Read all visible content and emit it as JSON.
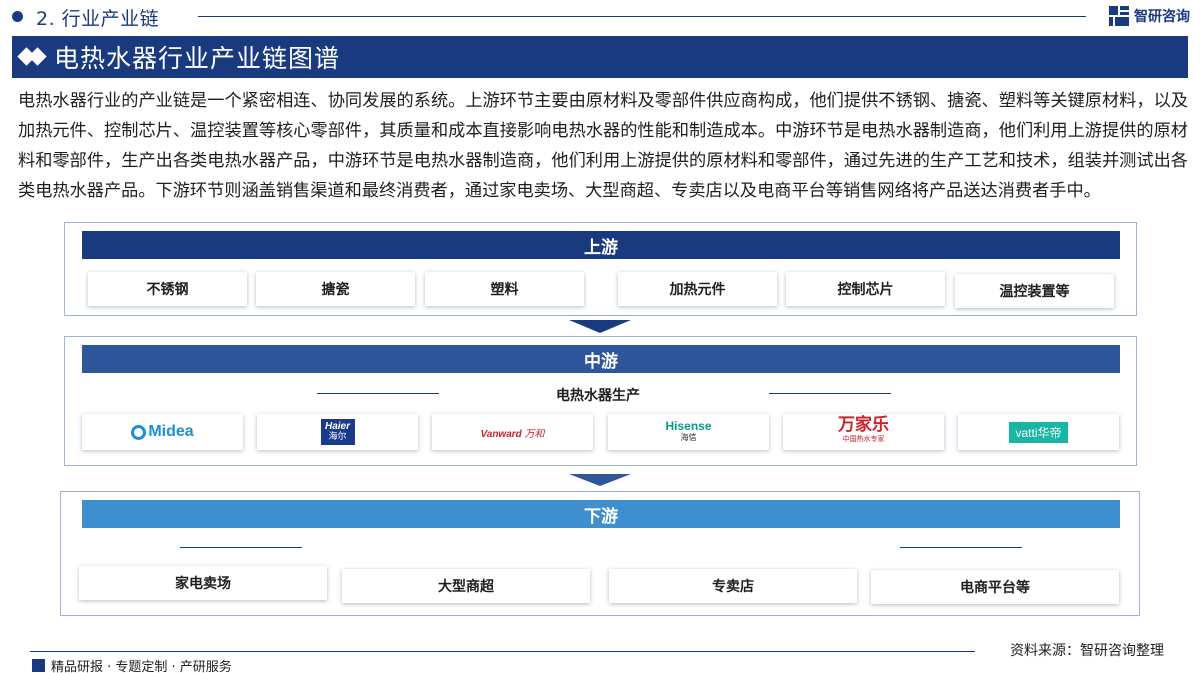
{
  "header": {
    "section_title": "2. 行业产业链",
    "brand_name": "智研咨询"
  },
  "banner": {
    "title": "电热水器行业产业链图谱"
  },
  "intro": "电热水器行业的产业链是一个紧密相连、协同发展的系统。上游环节主要由原材料及零部件供应商构成，他们提供不锈钢、搪瓷、塑料等关键原材料，以及加热元件、控制芯片、温控装置等核心零部件，其质量和成本直接影响电热水器的性能和制造成本。中游环节是电热水器制造商，他们利用上游提供的原材料和零部件，生产出各类电热水器产品，中游环节是电热水器制造商，他们利用上游提供的原材料和零部件，通过先进的生产工艺和技术，组装并测试出各类电热水器产品。下游环节则涵盖销售渠道和最终消费者，通过家电卖场、大型商超、专卖店以及电商平台等销售网络将产品送达消费者手中。",
  "upstream": {
    "label": "上游",
    "items": [
      "不锈钢",
      "搪瓷",
      "塑料",
      "加热元件",
      "控制芯片",
      "温控装置等"
    ]
  },
  "midstream": {
    "label": "中游",
    "subtitle": "电热水器生产",
    "logos": [
      {
        "name": "Midea"
      },
      {
        "en": "Haier",
        "cn": "海尔"
      },
      {
        "en": "Vanward",
        "cn": "万和"
      },
      {
        "en": "Hisense",
        "cn": "海信"
      },
      {
        "cn": "万家乐",
        "sub": "中国热水专家"
      },
      {
        "en": "vatti",
        "cn": "华帝"
      }
    ]
  },
  "downstream": {
    "label": "下游",
    "items": [
      "家电卖场",
      "大型商超",
      "专卖店",
      "电商平台等"
    ]
  },
  "footer": {
    "source": "资料来源：智研咨询整理",
    "tagline": "精品研报 · 专题定制 · 产研服务"
  },
  "colors": {
    "navy": "#1a3a80",
    "mid_blue": "#2f559b",
    "light_blue": "#3f8fd0"
  }
}
